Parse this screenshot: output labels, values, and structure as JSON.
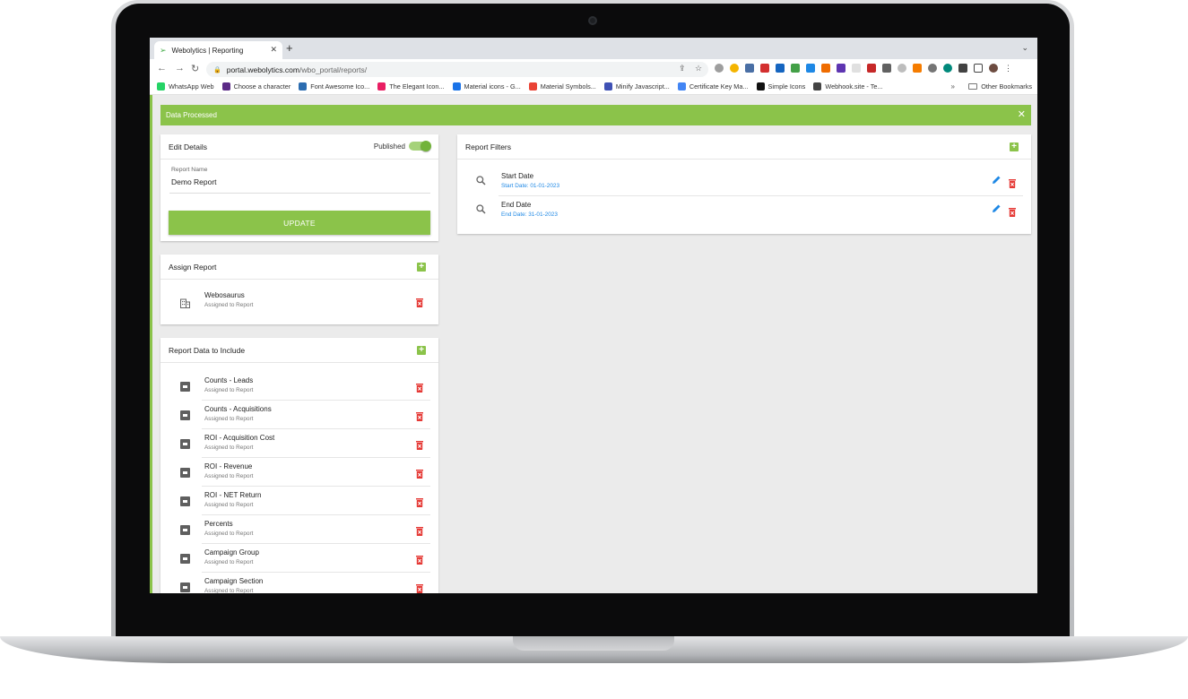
{
  "browser": {
    "tab_title": "Webolytics | Reporting",
    "new_tab": "+",
    "url_domain": "portal.webolytics.com",
    "url_path": "/wbo_portal/reports/",
    "bookmarks": [
      {
        "label": "WhatsApp Web",
        "color": "#25d366"
      },
      {
        "label": "Choose a character",
        "color": "#5b2a86"
      },
      {
        "label": "Font Awesome Ico...",
        "color": "#2b6cb0"
      },
      {
        "label": "The Elegant Icon...",
        "color": "#e91e63"
      },
      {
        "label": "Material icons - G...",
        "color": "#1a73e8"
      },
      {
        "label": "Material Symbols...",
        "color": "#ea4335"
      },
      {
        "label": "Minify Javascript...",
        "color": "#3f51b5"
      },
      {
        "label": "Certificate Key Ma...",
        "color": "#4285f4"
      },
      {
        "label": "Simple Icons",
        "color": "#111111"
      },
      {
        "label": "Webhook.site - Te...",
        "color": "#444444"
      }
    ],
    "bookmarks_more": "»",
    "other_bookmarks": "Other Bookmarks"
  },
  "alert": {
    "message": "Data Processed",
    "close": "✕"
  },
  "edit_details": {
    "title": "Edit Details",
    "published_label": "Published",
    "published": true,
    "field_label": "Report Name",
    "field_value": "Demo Report",
    "update_label": "UPDATE"
  },
  "assign_report": {
    "title": "Assign Report",
    "items": [
      {
        "title": "Webosaurus",
        "subtitle": "Assigned to Report"
      }
    ]
  },
  "report_data": {
    "title": "Report Data to Include",
    "items": [
      {
        "title": "Counts - Leads",
        "subtitle": "Assigned to Report"
      },
      {
        "title": "Counts - Acquisitions",
        "subtitle": "Assigned to Report"
      },
      {
        "title": "ROI - Acquisition Cost",
        "subtitle": "Assigned to Report"
      },
      {
        "title": "ROI - Revenue",
        "subtitle": "Assigned to Report"
      },
      {
        "title": "ROI - NET Return",
        "subtitle": "Assigned to Report"
      },
      {
        "title": "Percents",
        "subtitle": "Assigned to Report"
      },
      {
        "title": "Campaign Group",
        "subtitle": "Assigned to Report"
      },
      {
        "title": "Campaign Section",
        "subtitle": "Assigned to Report"
      }
    ]
  },
  "report_filters": {
    "title": "Report Filters",
    "items": [
      {
        "title": "Start Date",
        "subtitle": "Start Date: 01-01-2023"
      },
      {
        "title": "End Date",
        "subtitle": "End Date: 31-01-2023"
      }
    ]
  },
  "colors": {
    "accent": "#8bc34a",
    "danger": "#e53935",
    "link": "#1e88e5"
  }
}
